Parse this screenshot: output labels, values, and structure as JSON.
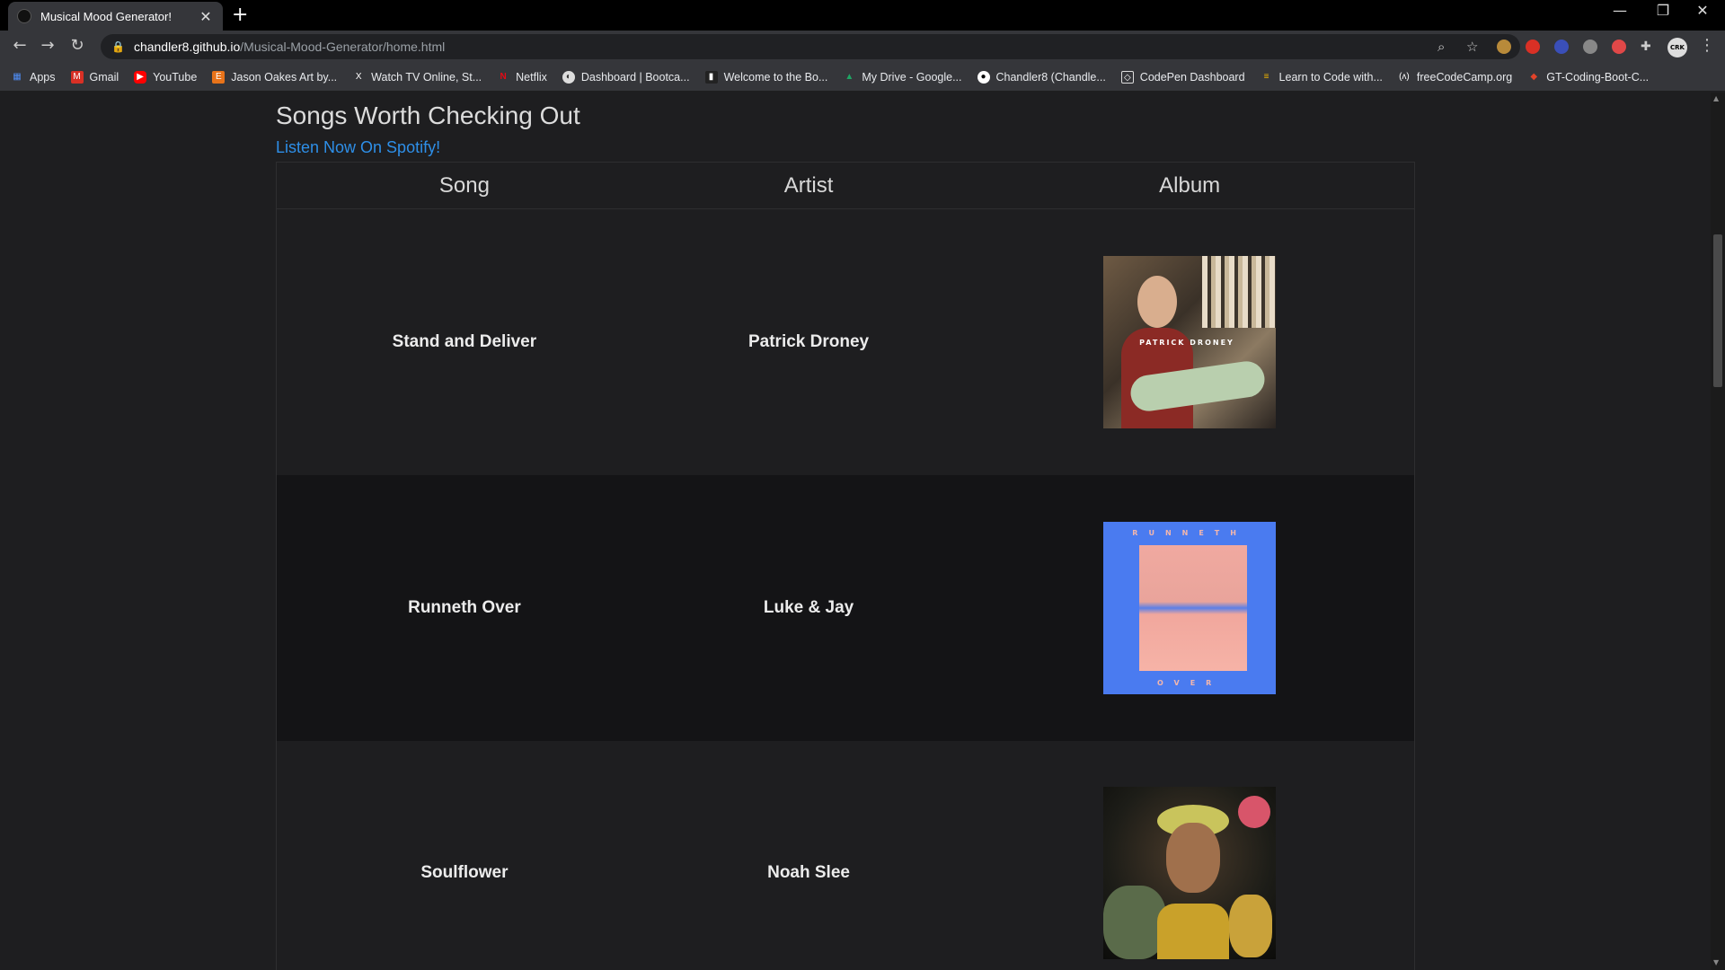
{
  "browser": {
    "tab_title": "Musical Mood Generator!",
    "url_host": "chandler8.github.io",
    "url_path": "/Musical-Mood-Generator/home.html",
    "bookmarks": [
      "Apps",
      "Gmail",
      "YouTube",
      "Jason Oakes Art by...",
      "Watch TV Online, St...",
      "Netflix",
      "Dashboard | Bootca...",
      "Welcome to the Bo...",
      "My Drive - Google...",
      "Chandler8 (Chandle...",
      "CodePen Dashboard",
      "Learn to Code with...",
      "freeCodeCamp.org",
      "GT-Coding-Boot-C..."
    ]
  },
  "page": {
    "section_title": "Songs Worth Checking Out",
    "spotify_link": "Listen Now On Spotify!",
    "columns": [
      "Song",
      "Artist",
      "Album"
    ],
    "rows": [
      {
        "song": "Stand and Deliver",
        "artist": "Patrick Droney",
        "album_text": "PATRICK DRONEY"
      },
      {
        "song": "Runneth Over",
        "artist": "Luke & Jay",
        "album_text_top": "RUNNETH",
        "album_text_bottom": "OVER"
      },
      {
        "song": "Soulflower",
        "artist": "Noah Slee"
      }
    ]
  },
  "colors": {
    "link": "#2e8fe8",
    "background": "#1e1e20",
    "row_alt": "#141416"
  }
}
